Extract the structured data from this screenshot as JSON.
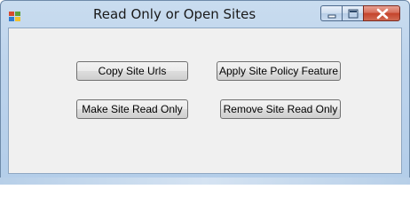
{
  "window": {
    "title": "Read Only or Open Sites",
    "app_icon": "windows-forms-app-icon",
    "caption_buttons": {
      "minimize_icon": "minimize-icon",
      "maximize_icon": "maximize-icon",
      "close_icon": "close-icon"
    }
  },
  "buttons": {
    "copy_site_urls": "Copy Site Urls",
    "apply_site_policy_feature": "Apply Site Policy Feature",
    "make_site_read_only": "Make Site Read Only",
    "remove_site_read_only": "Remove Site Read Only"
  },
  "colors": {
    "title_bar": "#bcd3ec",
    "client_area": "#f0f0f0",
    "close_button": "#c5432b"
  }
}
